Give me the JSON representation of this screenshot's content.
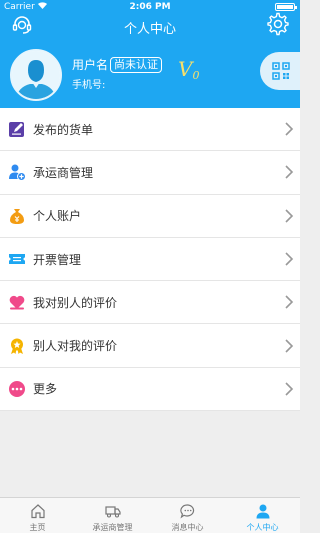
{
  "status_bar": {
    "carrier": "Carrier",
    "time": "2:06 PM"
  },
  "header": {
    "title": "个人中心",
    "username": "用户名",
    "verify_badge": "尚未认证",
    "vip_level": "V",
    "vip_number": "0",
    "phone_label": "手机号:",
    "bg_color": "#1ea7f2"
  },
  "menu": {
    "items": [
      {
        "label": "发布的货单",
        "icon": "edit-icon",
        "color": "#5b3fa8"
      },
      {
        "label": "承运商管理",
        "icon": "user-add-icon",
        "color": "#2f8bf0"
      },
      {
        "label": "个人账户",
        "icon": "money-bag-icon",
        "color": "#f39c12"
      },
      {
        "label": "开票管理",
        "icon": "ticket-icon",
        "color": "#1ea7f2"
      },
      {
        "label": "我对别人的评价",
        "icon": "heart-icon",
        "color": "#f04a8a"
      },
      {
        "label": "别人对我的评价",
        "icon": "medal-icon",
        "color": "#f5b400"
      },
      {
        "label": "更多",
        "icon": "more-icon",
        "color": "#f04a8a"
      }
    ]
  },
  "tabbar": {
    "tabs": [
      {
        "label": "主页",
        "icon": "home-icon"
      },
      {
        "label": "承运商管理",
        "icon": "truck-icon"
      },
      {
        "label": "消息中心",
        "icon": "message-icon"
      },
      {
        "label": "个人中心",
        "icon": "person-icon",
        "active": true
      }
    ]
  }
}
